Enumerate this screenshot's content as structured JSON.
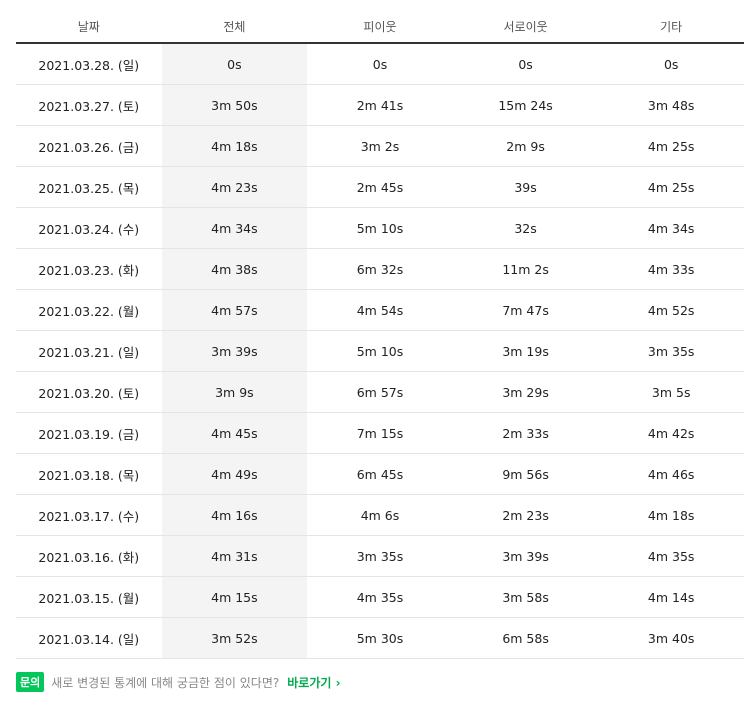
{
  "headers": [
    "날짜",
    "전체",
    "피이웃",
    "서로이웃",
    "기타"
  ],
  "rows": [
    [
      "2021.03.28. (일)",
      "0s",
      "0s",
      "0s",
      "0s"
    ],
    [
      "2021.03.27. (토)",
      "3m 50s",
      "2m 41s",
      "15m 24s",
      "3m 48s"
    ],
    [
      "2021.03.26. (금)",
      "4m 18s",
      "3m 2s",
      "2m 9s",
      "4m 25s"
    ],
    [
      "2021.03.25. (목)",
      "4m 23s",
      "2m 45s",
      "39s",
      "4m 25s"
    ],
    [
      "2021.03.24. (수)",
      "4m 34s",
      "5m 10s",
      "32s",
      "4m 34s"
    ],
    [
      "2021.03.23. (화)",
      "4m 38s",
      "6m 32s",
      "11m 2s",
      "4m 33s"
    ],
    [
      "2021.03.22. (월)",
      "4m 57s",
      "4m 54s",
      "7m 47s",
      "4m 52s"
    ],
    [
      "2021.03.21. (일)",
      "3m 39s",
      "5m 10s",
      "3m 19s",
      "3m 35s"
    ],
    [
      "2021.03.20. (토)",
      "3m 9s",
      "6m 57s",
      "3m 29s",
      "3m 5s"
    ],
    [
      "2021.03.19. (금)",
      "4m 45s",
      "7m 15s",
      "2m 33s",
      "4m 42s"
    ],
    [
      "2021.03.18. (목)",
      "4m 49s",
      "6m 45s",
      "9m 56s",
      "4m 46s"
    ],
    [
      "2021.03.17. (수)",
      "4m 16s",
      "4m 6s",
      "2m 23s",
      "4m 18s"
    ],
    [
      "2021.03.16. (화)",
      "4m 31s",
      "3m 35s",
      "3m 39s",
      "4m 35s"
    ],
    [
      "2021.03.15. (월)",
      "4m 15s",
      "4m 35s",
      "3m 58s",
      "4m 14s"
    ],
    [
      "2021.03.14. (일)",
      "3m 52s",
      "5m 30s",
      "6m 58s",
      "3m 40s"
    ]
  ],
  "footer": {
    "badge": "문의",
    "text": "새로 변경된 통계에 대해 궁금한 점이 있다면?",
    "link": "바로가기 ›"
  },
  "colors": {
    "accent": "#03c75a",
    "highlight_column": "#f4f4f4"
  }
}
